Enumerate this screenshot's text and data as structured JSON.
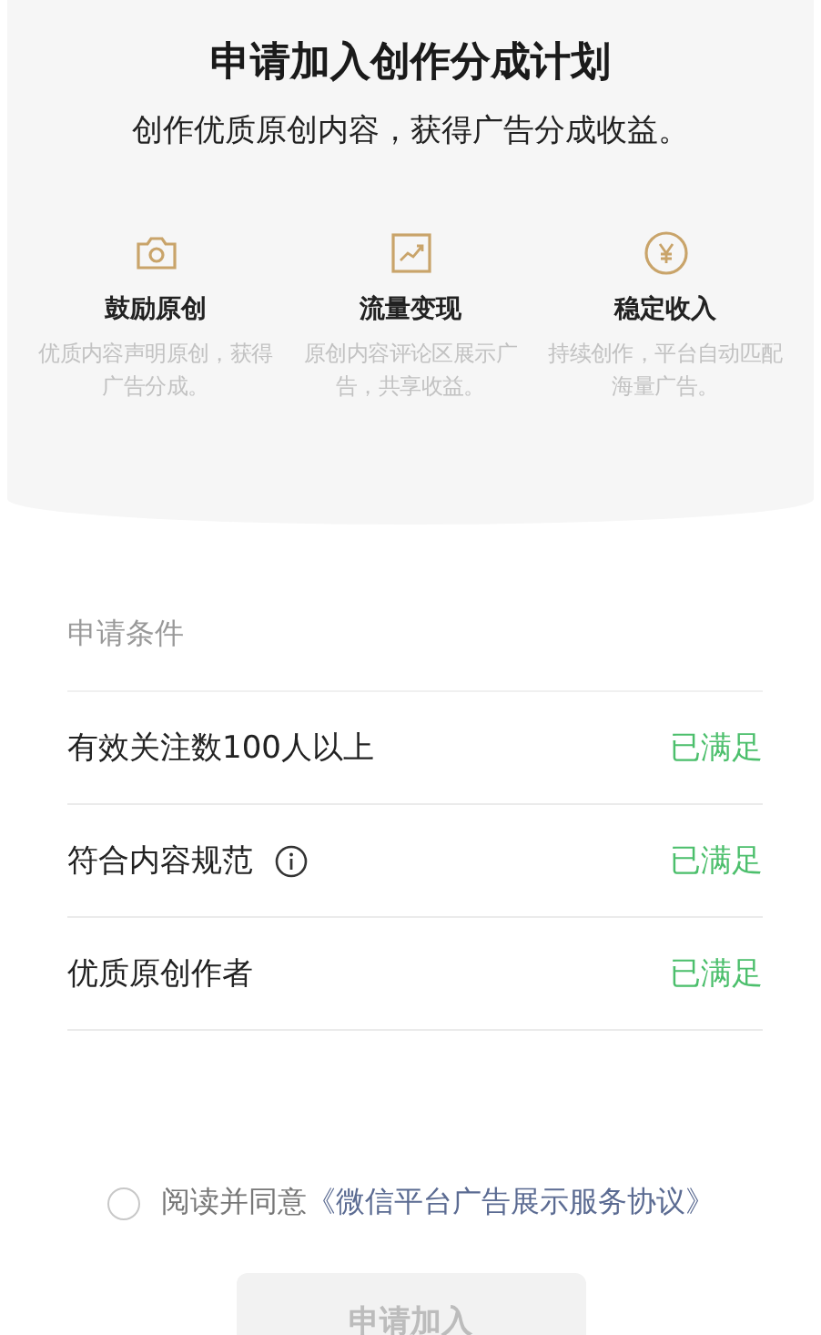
{
  "header": {
    "title": "申请加入创作分成计划",
    "subtitle": "创作优质原创内容，获得广告分成收益。"
  },
  "features": [
    {
      "kind": "camera",
      "title": "鼓励原创",
      "description": "优质内容声明原创，获得广告分成。"
    },
    {
      "kind": "chart",
      "title": "流量变现",
      "description": "原创内容评论区展示广告，共享收益。"
    },
    {
      "kind": "yen",
      "title": "稳定收入",
      "description": "持续创作，平台自动匹配海量广告。"
    }
  ],
  "conditions": {
    "heading": "申请条件",
    "items": [
      {
        "label": "有效关注数100人以上",
        "info": false,
        "met": true,
        "status": "已满足"
      },
      {
        "label": "符合内容规范",
        "info": true,
        "met": true,
        "status": "已满足"
      },
      {
        "label": "优质原创作者",
        "info": false,
        "met": true,
        "status": "已满足"
      }
    ]
  },
  "agreement": {
    "checked": false,
    "text": "阅读并同意",
    "link": "《微信平台广告展示服务协议》"
  },
  "submit": {
    "label": "申请加入",
    "disabled": true
  }
}
